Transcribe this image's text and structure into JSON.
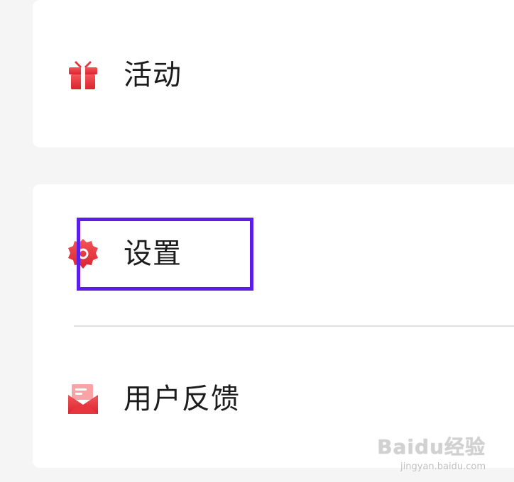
{
  "menu": {
    "activity": {
      "label": "活动",
      "icon": "gift-icon"
    },
    "settings": {
      "label": "设置",
      "icon": "gear-icon"
    },
    "feedback": {
      "label": "用户反馈",
      "icon": "mail-icon"
    }
  },
  "colors": {
    "icon_red": "#e8363f",
    "highlight": "#5a1ee8",
    "text": "#1c1c1c",
    "background": "#f5f5f5",
    "card": "#ffffff"
  },
  "watermark": {
    "main": "Baidu经验",
    "sub": "jingyan.baidu.com"
  }
}
